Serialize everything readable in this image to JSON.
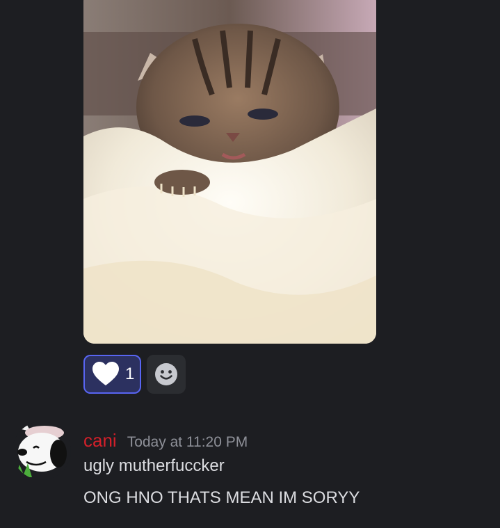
{
  "attachment": {
    "kind": "image",
    "subject": "kitten-photo"
  },
  "reactions": [
    {
      "emoji": "heart-icon",
      "count": "1",
      "active": true,
      "accent": "#5865f2"
    },
    {
      "emoji": "add-reaction-icon"
    }
  ],
  "message": {
    "username": "cani",
    "username_color": "#d3202a",
    "timestamp": "Today at 11:20 PM",
    "lines": [
      "ugly mutherfuccker",
      "ONG HNO THATS MEAN IM SORYY"
    ]
  },
  "colors": {
    "background": "#1d1e22",
    "text": "#dcdde1",
    "muted": "#8e9098"
  }
}
